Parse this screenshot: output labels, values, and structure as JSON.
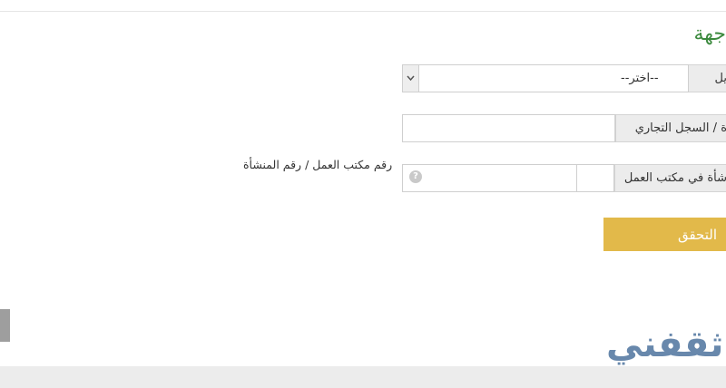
{
  "form": {
    "title": "جهة",
    "row1": {
      "label": "يل",
      "selected_value": "--اختر--"
    },
    "row2": {
      "label": "ة / السجل التجاري",
      "value": ""
    },
    "row3": {
      "label": "شأة في مكتب العمل",
      "office_value": "",
      "number_value": ""
    },
    "hint": "رقم مكتب العمل / رقم المنشأة",
    "help_symbol": "?",
    "submit_label": "التحقق"
  },
  "watermark": {
    "text": "ثقفني"
  },
  "colors": {
    "title_green": "#3c8a3e",
    "button_gold": "#e2b94a",
    "watermark_blue": "#5c7ea6"
  }
}
